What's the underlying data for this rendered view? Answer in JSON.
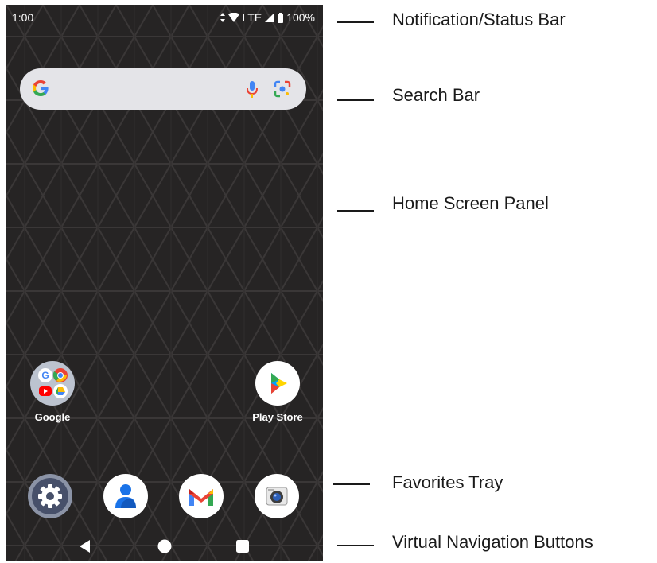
{
  "status_bar": {
    "time": "1:00",
    "network": "LTE",
    "battery": "100%",
    "icons": [
      "data-arrows-icon",
      "wifi-icon",
      "signal-icon",
      "battery-icon"
    ]
  },
  "search_bar": {
    "icons": [
      "google-g-icon",
      "microphone-icon",
      "lens-icon"
    ]
  },
  "home_apps": [
    {
      "label": "Google",
      "icon": "google-folder-icon"
    },
    {
      "label": "Play Store",
      "icon": "play-store-icon"
    }
  ],
  "favorites_tray": [
    "settings-icon",
    "contacts-icon",
    "gmail-icon",
    "camera-icon"
  ],
  "navigation": [
    "back-icon",
    "home-icon",
    "recents-icon"
  ],
  "callouts": [
    "Notification/Status Bar",
    "Search Bar",
    "Home Screen Panel",
    "Favorites Tray",
    "Virtual Navigation Buttons"
  ],
  "colors": {
    "wallpaper": "#262424",
    "search_bar": "#e4e4e8",
    "callout_text": "#1a1a1a"
  }
}
